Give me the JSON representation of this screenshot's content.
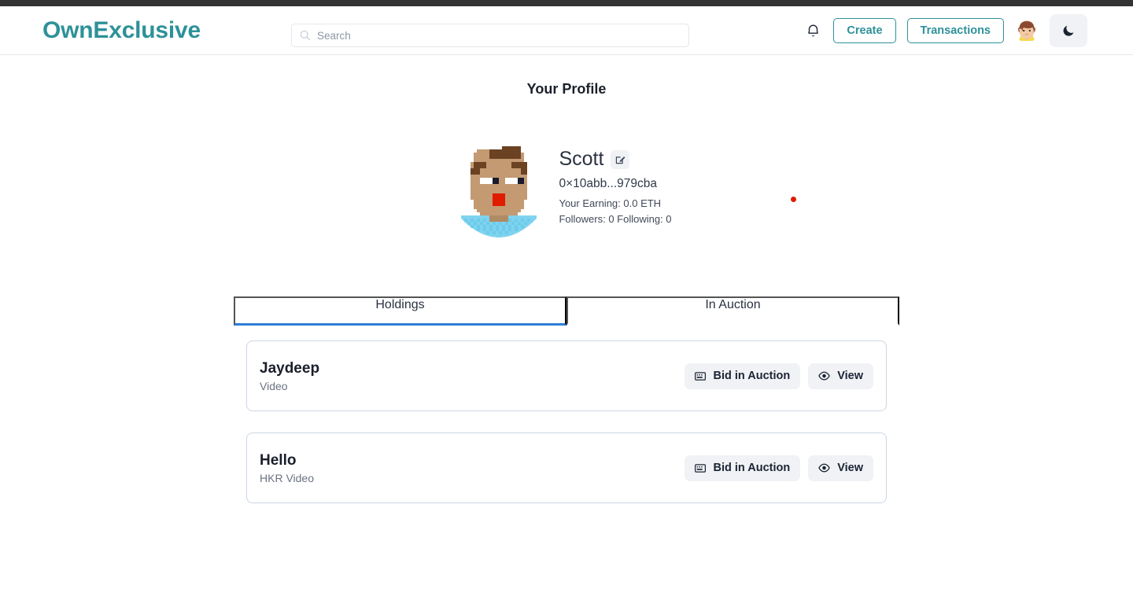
{
  "header": {
    "logo": "OwnExclusive",
    "search": {
      "placeholder": "Search",
      "value": "",
      "icon": "search-icon"
    },
    "bell_icon": "notification-bell-icon",
    "create_label": "Create",
    "transactions_label": "Transactions",
    "avatar_icon": "user-avatar",
    "theme_icon": "moon-icon",
    "accent_color": "#2e9199"
  },
  "page": {
    "title": "Your Profile"
  },
  "profile": {
    "avatar_icon": "pixel-art-avatar",
    "name": "Scott",
    "edit_icon": "edit-pencil-icon",
    "wallet": "0×10abb...979cba",
    "earning": "Your Earning: 0.0 ETH",
    "social": "Followers: 0  Following: 0",
    "status_dot_color": "#e01b00"
  },
  "tabs": [
    {
      "label": "Holdings",
      "active": true
    },
    {
      "label": "In Auction",
      "active": false
    }
  ],
  "tabs_active_color": "#2f7ed8",
  "cards": [
    {
      "title": "Jaydeep",
      "subtitle": "Video",
      "bid_label": "Bid in Auction",
      "bid_icon": "keyboard-icon",
      "view_label": "View",
      "view_icon": "eye-icon"
    },
    {
      "title": "Hello",
      "subtitle": "HKR Video",
      "bid_label": "Bid in Auction",
      "bid_icon": "keyboard-icon",
      "view_label": "View",
      "view_icon": "eye-icon"
    }
  ]
}
